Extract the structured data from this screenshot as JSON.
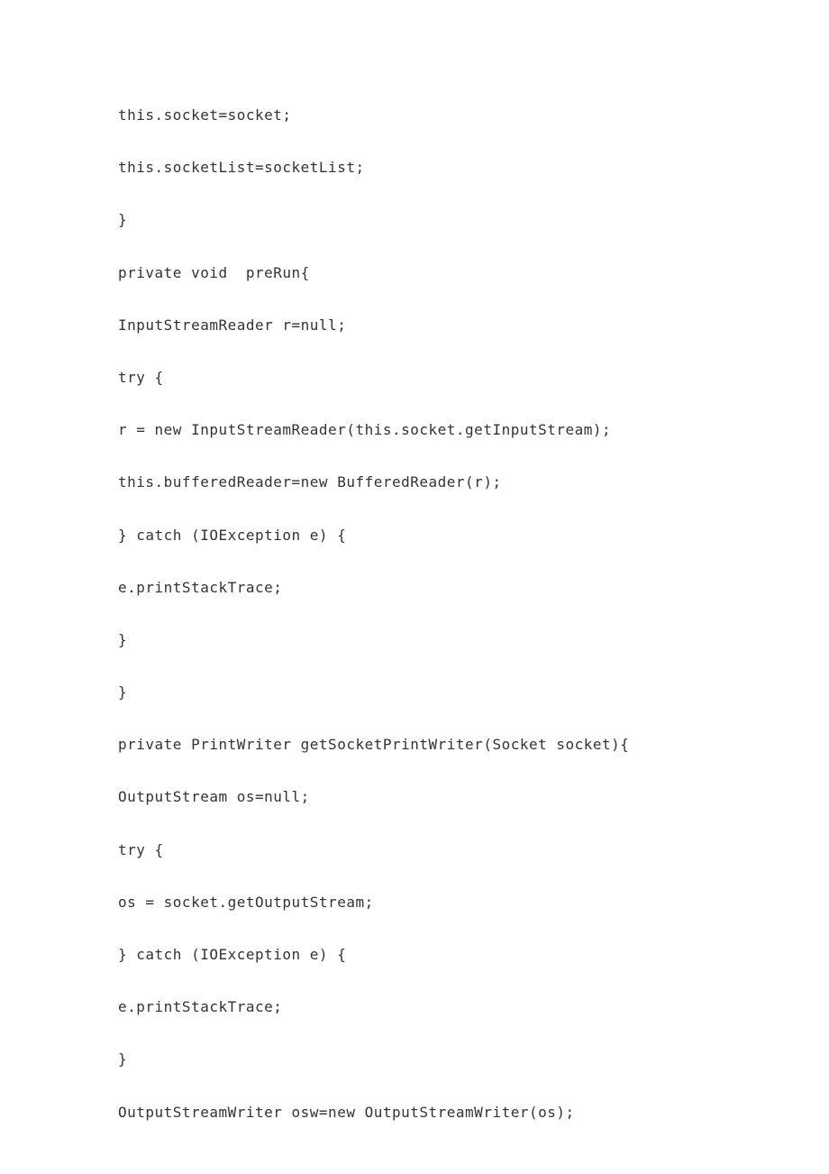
{
  "lines": [
    "this.socket=socket;",
    "this.socketList=socketList;",
    "}",
    "private void  preRun{",
    "InputStreamReader r=null;",
    "try {",
    "r = new InputStreamReader(this.socket.getInputStream);",
    "this.bufferedReader=new BufferedReader(r);",
    "} catch (IOException e) {",
    "e.printStackTrace;",
    "}",
    "}",
    "private PrintWriter getSocketPrintWriter(Socket socket){",
    "OutputStream os=null;",
    "try {",
    "os = socket.getOutputStream;",
    "} catch (IOException e) {",
    "e.printStackTrace;",
    "}",
    "OutputStreamWriter osw=new OutputStreamWriter(os);"
  ]
}
